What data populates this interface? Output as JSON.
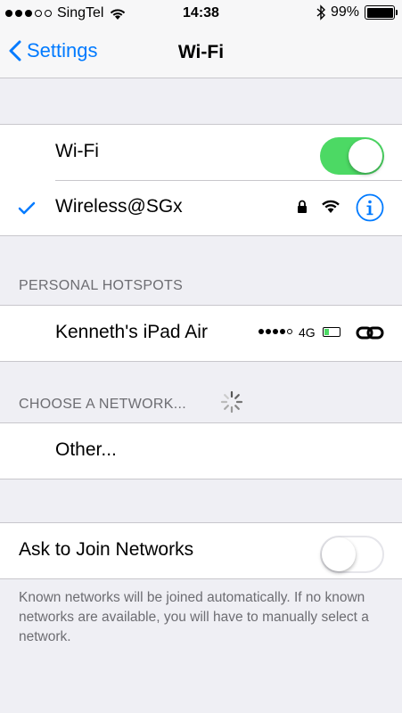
{
  "status_bar": {
    "carrier": "SingTel",
    "time": "14:38",
    "battery_percent": "99%",
    "signal_dots": 5,
    "signal_filled": 3
  },
  "nav": {
    "back_label": "Settings",
    "title": "Wi-Fi"
  },
  "wifi_section": {
    "toggle_label": "Wi-Fi",
    "toggle_on": true,
    "connected_network": "Wireless@SGx"
  },
  "hotspots": {
    "header": "PERSONAL HOTSPOTS",
    "items": [
      {
        "name": "Kenneth's iPad Air",
        "network_type": "4G"
      }
    ]
  },
  "choose": {
    "header": "CHOOSE A NETWORK...",
    "other_label": "Other..."
  },
  "ask_join": {
    "label": "Ask to Join Networks",
    "toggle_on": false,
    "footer": "Known networks will be joined automatically. If no known networks are available, you will have to manually select a network."
  },
  "colors": {
    "accent": "#007aff",
    "toggle_on": "#4cd964",
    "background": "#efeff4"
  }
}
